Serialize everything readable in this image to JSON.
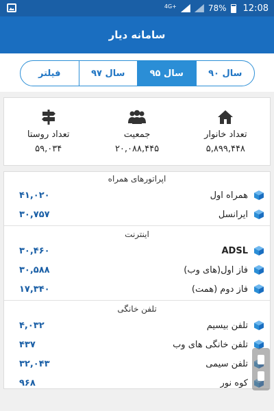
{
  "status": {
    "network": "4G+",
    "battery": "78%",
    "time": "12:08"
  },
  "appbar": {
    "title": "سامانه دیار"
  },
  "tabs": [
    {
      "label": "سال ۹۰",
      "active": false
    },
    {
      "label": "سال ۹۵",
      "active": true
    },
    {
      "label": "سال ۹۷",
      "active": false
    },
    {
      "label": "فیلتر",
      "active": false
    }
  ],
  "stats": [
    {
      "icon": "house-icon",
      "label": "تعداد خانوار",
      "value": "۵,۸۹۹,۴۴۸"
    },
    {
      "icon": "people-icon",
      "label": "جمعیت",
      "value": "۲۰,۰۸۸,۴۴۵"
    },
    {
      "icon": "signpost-icon",
      "label": "تعداد روستا",
      "value": "۵۹,۰۳۴"
    }
  ],
  "sections": [
    {
      "title": "اپراتورهای همراه",
      "rows": [
        {
          "name": "همراه اول",
          "value": "۴۱,۰۲۰"
        },
        {
          "name": "ایرانسل",
          "value": "۳۰,۷۵۷"
        }
      ]
    },
    {
      "title": "اینترنت",
      "rows": [
        {
          "name": "ADSL",
          "value": "۳۰,۴۶۰"
        },
        {
          "name": "فاز اول(های وب)",
          "value": "۳۰,۵۸۸"
        },
        {
          "name": "فاز دوم (همت)",
          "value": "۱۷,۳۴۰"
        }
      ]
    },
    {
      "title": "تلفن خانگی",
      "rows": [
        {
          "name": "تلفن بیسیم",
          "value": "۴,۰۳۲"
        },
        {
          "name": "تلفن خانگی های وب",
          "value": "۴۳۷"
        },
        {
          "name": "تلفن سیمی",
          "value": "۳۲,۰۴۳"
        },
        {
          "name": "کوه نور",
          "value": "۹۶۸"
        }
      ]
    }
  ],
  "colors": {
    "appbar": "#1a6ec0",
    "accent": "#2b8ed6",
    "value_text": "#1a5fa6"
  }
}
